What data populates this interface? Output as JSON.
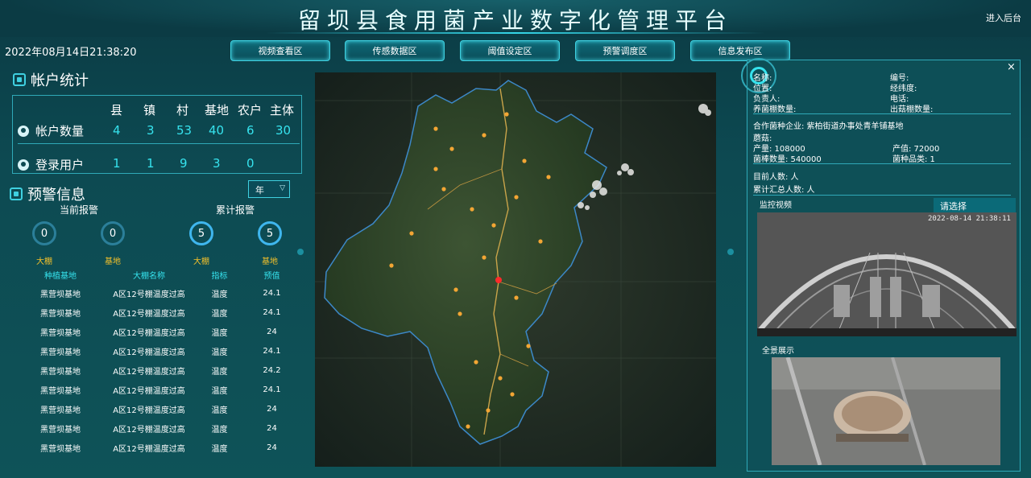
{
  "header": {
    "title": "留坝县食用菌产业数字化管理平台",
    "backstage_link": "进入后台",
    "datetime": "2022年08月14日21:38:20"
  },
  "nav": [
    {
      "label": "视频查看区"
    },
    {
      "label": "传感数据区"
    },
    {
      "label": "阈值设定区"
    },
    {
      "label": "预警调度区"
    },
    {
      "label": "信息发布区"
    }
  ],
  "accounts": {
    "title": "帐户统计",
    "columns": [
      "县",
      "镇",
      "村",
      "基地",
      "农户",
      "主体"
    ],
    "rows": [
      {
        "label": "帐户数量",
        "values": [
          "4",
          "3",
          "53",
          "40",
          "6",
          "30"
        ]
      },
      {
        "label": "登录用户",
        "values": [
          "1",
          "1",
          "9",
          "3",
          "0",
          ""
        ]
      }
    ]
  },
  "warnings": {
    "title": "预警信息",
    "period_select": "年",
    "current_label": "当前报警",
    "total_label": "累计报警",
    "rings": [
      {
        "value": "0",
        "label": "大棚",
        "filled": false
      },
      {
        "value": "0",
        "label": "基地",
        "filled": false
      },
      {
        "value": "5",
        "label": "大棚",
        "filled": true
      },
      {
        "value": "5",
        "label": "基地",
        "filled": true
      }
    ],
    "table_headers": [
      "种植基地",
      "大棚名称",
      "指标",
      "预值"
    ],
    "table_rows": [
      [
        "黑营坝基地",
        "A区12号棚温度过高",
        "温度",
        "24.1"
      ],
      [
        "黑营坝基地",
        "A区12号棚温度过高",
        "温度",
        "24.1"
      ],
      [
        "黑营坝基地",
        "A区12号棚温度过高",
        "温度",
        "24"
      ],
      [
        "黑营坝基地",
        "A区12号棚温度过高",
        "温度",
        "24.1"
      ],
      [
        "黑营坝基地",
        "A区12号棚温度过高",
        "温度",
        "24.2"
      ],
      [
        "黑营坝基地",
        "A区12号棚温度过高",
        "温度",
        "24.1"
      ],
      [
        "黑营坝基地",
        "A区12号棚温度过高",
        "温度",
        "24"
      ],
      [
        "黑营坝基地",
        "A区12号棚温度过高",
        "温度",
        "24"
      ],
      [
        "黑营坝基地",
        "A区12号棚温度过高",
        "温度",
        "24"
      ]
    ]
  },
  "detail": {
    "close": "×",
    "name_label": "名称:",
    "code_label": "编号:",
    "location_label": "位置:",
    "lnglat_label": "经纬度:",
    "manager_label": "负责人:",
    "phone_label": "电话:",
    "shed_count_label": "养菌棚数量:",
    "fruit_shed_label": "出菇棚数量:",
    "partner_label": "合作菌种企业: 紫柏街道办事处青羊铺基地",
    "species_label": "蘑菇:",
    "yield_label": "产量: 108000",
    "output_label": "产值: 72000",
    "stick_label": "菌棒数量: 540000",
    "variety_label": "菌种品类: 1",
    "people_now": "目前人数: 人",
    "people_total": "累计汇总人数: 人",
    "video_title": "监控视频",
    "video_select": "请选择",
    "video_timestamp": "2022-08-14 21:38:11",
    "panorama_title": "全景展示"
  },
  "colors": {
    "accent": "#36e3ee",
    "warn": "#f5c12a",
    "border": "#2fa9b8"
  }
}
